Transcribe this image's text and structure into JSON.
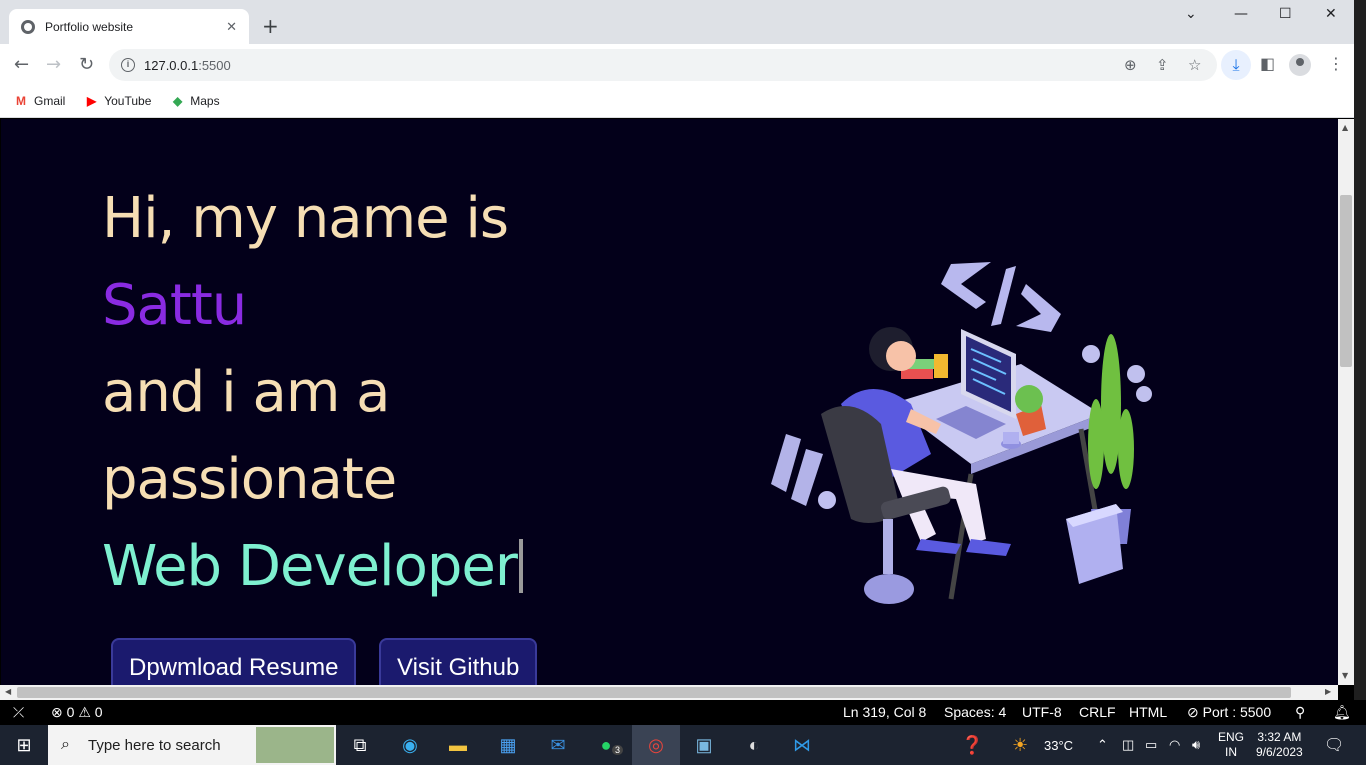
{
  "browser": {
    "tab_title": "Portfolio website",
    "tab_close": "✕",
    "new_tab": "+",
    "url_host": "127.0.0.1",
    "url_port": ":5500",
    "bookmarks": [
      {
        "label": "Gmail",
        "icon": "gmail-icon",
        "glyph": "M",
        "color": "#ea4335"
      },
      {
        "label": "YouTube",
        "icon": "youtube-icon",
        "glyph": "▶",
        "color": "#ff0000"
      },
      {
        "label": "Maps",
        "icon": "maps-icon",
        "glyph": "◆",
        "color": "#34a853"
      }
    ]
  },
  "hero": {
    "line1": "Hi, my name is",
    "name": "Sattu",
    "line3": "and i am a",
    "line4": "passionate",
    "role": "Web Developer"
  },
  "buttons": {
    "resume": "Dpwmload Resume",
    "github": "Visit Github"
  },
  "statusbar": {
    "errors": "0",
    "warnings": "0",
    "position": "Ln 319, Col 8",
    "spaces": "Spaces: 4",
    "encoding": "UTF-8",
    "eol": "CRLF",
    "language": "HTML",
    "port": "Port : 5500"
  },
  "taskbar": {
    "search_placeholder": "Type here to search",
    "whatsapp_badge": "3",
    "weather": "33°C",
    "lang_top": "ENG",
    "lang_bottom": "IN",
    "time": "3:32 AM",
    "date": "9/6/2023"
  },
  "colors": {
    "page_bg": "#03001a",
    "hero_text": "#f6deb4",
    "name": "#8a2be2",
    "role": "#7ef0d0",
    "button_bg": "#1b1a6e"
  }
}
